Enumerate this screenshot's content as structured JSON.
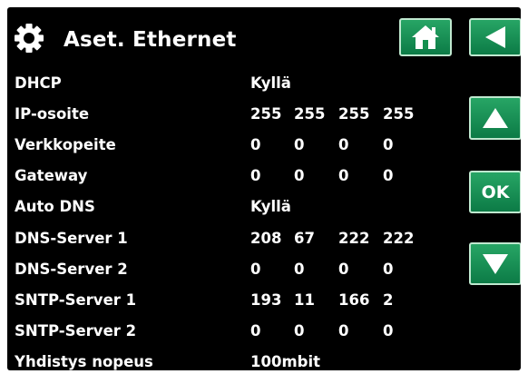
{
  "header": {
    "title": "Aset. Ethernet",
    "icon": "gear-icon"
  },
  "buttons": {
    "home_icon": "home-icon",
    "back_icon": "back-arrow-icon",
    "up_icon": "arrow-up-icon",
    "ok_label": "OK",
    "down_icon": "arrow-down-icon",
    "accent_color": "#13904f"
  },
  "settings": {
    "dhcp": {
      "label": "DHCP",
      "value": "Kyllä"
    },
    "ip_address": {
      "label": "IP-osoite",
      "octets": [
        "255",
        "255",
        "255",
        "255"
      ]
    },
    "netmask": {
      "label": "Verkkopeite",
      "octets": [
        "0",
        "0",
        "0",
        "0"
      ]
    },
    "gateway": {
      "label": "Gateway",
      "octets": [
        "0",
        "0",
        "0",
        "0"
      ]
    },
    "auto_dns": {
      "label": "Auto DNS",
      "value": "Kyllä"
    },
    "dns_server_1": {
      "label": "DNS-Server 1",
      "octets": [
        "208",
        "67",
        "222",
        "222"
      ]
    },
    "dns_server_2": {
      "label": "DNS-Server 2",
      "octets": [
        "0",
        "0",
        "0",
        "0"
      ]
    },
    "sntp_server_1": {
      "label": "SNTP-Server 1",
      "octets": [
        "193",
        "11",
        "166",
        "2"
      ]
    },
    "sntp_server_2": {
      "label": "SNTP-Server 2",
      "octets": [
        "0",
        "0",
        "0",
        "0"
      ]
    },
    "link_speed": {
      "label": "Yhdistys nopeus",
      "value": "100mbit"
    }
  }
}
